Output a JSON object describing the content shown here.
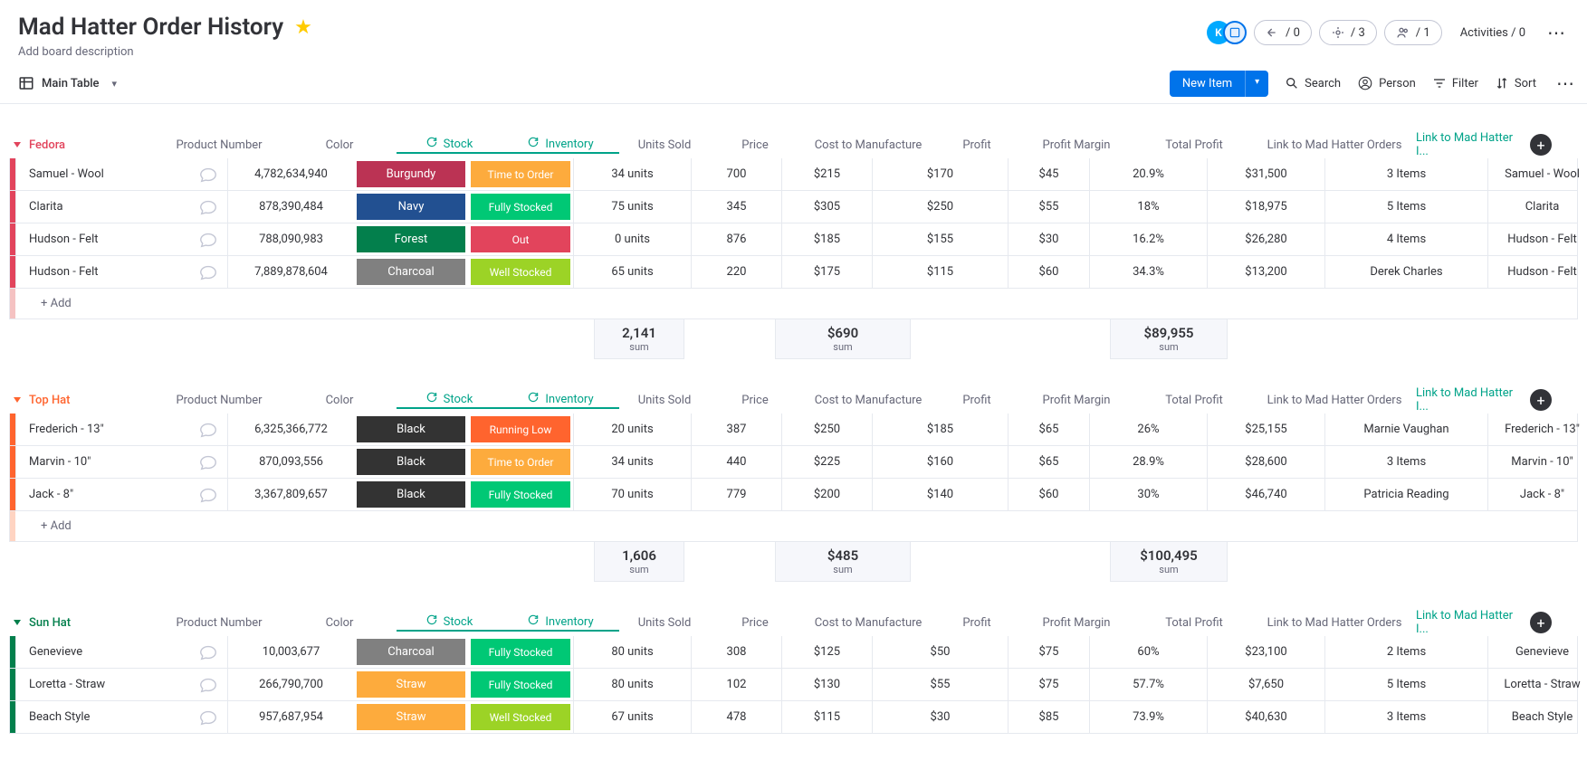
{
  "header": {
    "title": "Mad Hatter Order History",
    "description": "Add board description",
    "avatar_initial": "K",
    "pill1": "/ 0",
    "pill2": "/ 3",
    "pill3": "/ 1",
    "activities": "Activities / 0"
  },
  "toolbar": {
    "view": "Main Table",
    "new_item": "New Item",
    "search": "Search",
    "person": "Person",
    "filter": "Filter",
    "sort": "Sort"
  },
  "columns": {
    "pn": "Product Number",
    "color": "Color",
    "stock": "Stock",
    "inv": "Inventory",
    "us": "Units Sold",
    "price": "Price",
    "ctm": "Cost to Manufacture",
    "profit": "Profit",
    "pm": "Profit Margin",
    "tp": "Total Profit",
    "link1": "Link to Mad Hatter Orders",
    "link2": "Link to Mad Hatter I..."
  },
  "colors": {
    "Burgundy": "#bb3354",
    "Navy": "#225091",
    "Forest": "#037f4c",
    "Charcoal": "#808080",
    "Black": "#333333",
    "Straw": "#fdab3d"
  },
  "stock_colors": {
    "Time to Order": "#fdab3d",
    "Fully Stocked": "#00c875",
    "Out": "#e2445c",
    "Well Stocked": "#9cd326",
    "Running Low": "#ff642e"
  },
  "groups": [
    {
      "name": "Fedora",
      "color": "#e2445c",
      "rows": [
        {
          "name": "Samuel - Wool",
          "pn": "4,782,634,940",
          "color": "Burgundy",
          "stock": "Time to Order",
          "inv": "34 units",
          "us": "700",
          "price": "$215",
          "ctm": "$170",
          "profit": "$45",
          "pm": "20.9%",
          "tp": "$31,500",
          "link1": "3 Items",
          "link2": "Samuel - Wool"
        },
        {
          "name": "Clarita",
          "pn": "878,390,484",
          "color": "Navy",
          "stock": "Fully Stocked",
          "inv": "75 units",
          "us": "345",
          "price": "$305",
          "ctm": "$250",
          "profit": "$55",
          "pm": "18%",
          "tp": "$18,975",
          "link1": "5 Items",
          "link2": "Clarita"
        },
        {
          "name": "Hudson - Felt",
          "pn": "788,090,983",
          "color": "Forest",
          "stock": "Out",
          "inv": "0 units",
          "us": "876",
          "price": "$185",
          "ctm": "$155",
          "profit": "$30",
          "pm": "16.2%",
          "tp": "$26,280",
          "link1": "4 Items",
          "link2": "Hudson - Felt"
        },
        {
          "name": "Hudson - Felt",
          "pn": "7,889,878,604",
          "color": "Charcoal",
          "stock": "Well Stocked",
          "inv": "65 units",
          "us": "220",
          "price": "$175",
          "ctm": "$115",
          "profit": "$60",
          "pm": "34.3%",
          "tp": "$13,200",
          "link1": "Derek Charles",
          "link2": "Hudson - Felt"
        }
      ],
      "footer": {
        "us": "2,141",
        "ctm": "$690",
        "tp": "$89,955",
        "lbl": "sum"
      },
      "add_color": "#f5c2c2"
    },
    {
      "name": "Top Hat",
      "color": "#ff642e",
      "rows": [
        {
          "name": "Frederich - 13\"",
          "pn": "6,325,366,772",
          "color": "Black",
          "stock": "Running Low",
          "inv": "20 units",
          "us": "387",
          "price": "$250",
          "ctm": "$185",
          "profit": "$65",
          "pm": "26%",
          "tp": "$25,155",
          "link1": "Marnie Vaughan",
          "link2": "Frederich - 13\""
        },
        {
          "name": "Marvin - 10\"",
          "pn": "870,093,556",
          "color": "Black",
          "stock": "Time to Order",
          "inv": "34 units",
          "us": "440",
          "price": "$225",
          "ctm": "$160",
          "profit": "$65",
          "pm": "28.9%",
          "tp": "$28,600",
          "link1": "3 Items",
          "link2": "Marvin - 10\""
        },
        {
          "name": "Jack - 8\"",
          "pn": "3,367,809,657",
          "color": "Black",
          "stock": "Fully Stocked",
          "inv": "70 units",
          "us": "779",
          "price": "$200",
          "ctm": "$140",
          "profit": "$60",
          "pm": "30%",
          "tp": "$46,740",
          "link1": "Patricia Reading",
          "link2": "Jack - 8\""
        }
      ],
      "footer": {
        "us": "1,606",
        "ctm": "$485",
        "tp": "$100,495",
        "lbl": "sum"
      },
      "add_color": "#ffd4c2"
    },
    {
      "name": "Sun Hat",
      "color": "#037f4c",
      "rows": [
        {
          "name": "Genevieve",
          "pn": "10,003,677",
          "color": "Charcoal",
          "stock": "Fully Stocked",
          "inv": "80 units",
          "us": "308",
          "price": "$125",
          "ctm": "$50",
          "profit": "$75",
          "pm": "60%",
          "tp": "$23,100",
          "link1": "2 Items",
          "link2": "Genevieve"
        },
        {
          "name": "Loretta - Straw",
          "pn": "266,790,700",
          "color": "Straw",
          "stock": "Fully Stocked",
          "inv": "80 units",
          "us": "102",
          "price": "$130",
          "ctm": "$55",
          "profit": "$75",
          "pm": "57.7%",
          "tp": "$7,650",
          "link1": "5 Items",
          "link2": "Loretta - Straw"
        },
        {
          "name": "Beach Style",
          "pn": "957,687,954",
          "color": "Straw",
          "stock": "Well Stocked",
          "inv": "67 units",
          "us": "478",
          "price": "$115",
          "ctm": "$30",
          "profit": "$85",
          "pm": "73.9%",
          "tp": "$40,630",
          "link1": "3 Items",
          "link2": "Beach Style"
        }
      ],
      "footer": null,
      "add_color": "#b3dcc7"
    }
  ],
  "add_label": "+ Add"
}
